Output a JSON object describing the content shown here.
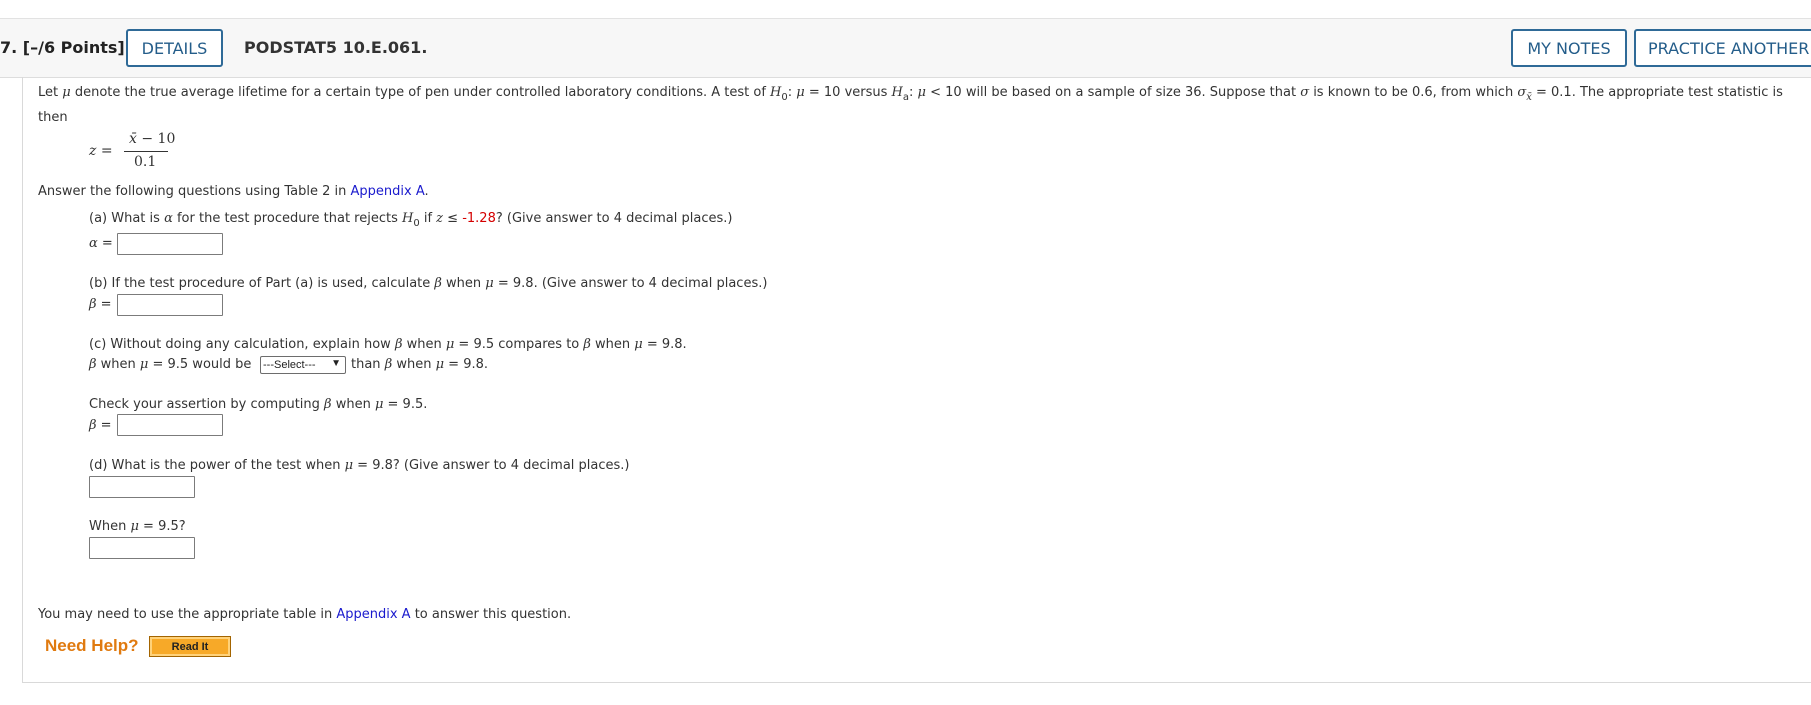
{
  "header": {
    "points": "7. [–/6 Points]",
    "details": "DETAILS",
    "code": "PODSTAT5 10.E.061.",
    "my_notes": "MY NOTES",
    "practice": "PRACTICE ANOTHER"
  },
  "problem": {
    "p1": "Let ",
    "mu": "μ",
    "p2": " denote the true average lifetime for a certain type of pen under controlled laboratory conditions. A test of ",
    "H": "H",
    "sub0": "0",
    "p3": ": ",
    "p4": " = 10 versus ",
    "suba": "a",
    "p5": ": ",
    "p6": " < 10 will be based on a sample of size 36. Suppose that ",
    "sigma": "σ",
    "p7": " is known to be 0.6, from which ",
    "subx": "x̄",
    "p8": " = 0.1. The appropriate test statistic is",
    "then": "then",
    "z": "z",
    "eq": " =",
    "numerator": "x̄ − 10",
    "denominator": "0.1"
  },
  "intro": {
    "text": "Answer the following questions using Table 2 in ",
    "link": "Appendix A",
    "period": "."
  },
  "part_a": {
    "t1": "(a) What is ",
    "alpha": "α",
    "t2": " for the test procedure that rejects ",
    "t3": " if ",
    "t4": " ≤ ",
    "value": "-1.28",
    "t5": "? (Give answer to 4 decimal places.)",
    "label_eq": " =",
    "answer": ""
  },
  "part_b": {
    "t1": "(b) If the test procedure of Part (a) is used, calculate ",
    "beta": "β",
    "t2": " when ",
    "t3": " = 9.8. (Give answer to 4 decimal places.)",
    "label_eq": " =",
    "answer": ""
  },
  "part_c": {
    "t1": "(c) Without doing any calculation, explain how ",
    "t2": " when ",
    "t3": " = 9.5 compares to ",
    "t4": " when ",
    "t5": " = 9.8.",
    "s1": " when ",
    "s2": " = 9.5 would be",
    "select_value": "---Select---",
    "s3": "than ",
    "s4": " when ",
    "s5": " = 9.8."
  },
  "check": {
    "t1": "Check your assertion by computing ",
    "t2": " when ",
    "t3": " = 9.5.",
    "label_eq": " =",
    "answer": ""
  },
  "part_d": {
    "t1": "(d) What is the power of the test when ",
    "t2": " = 9.8? (Give answer to 4 decimal places.)",
    "answer1": "",
    "when1": "When ",
    "when2": " = 9.5?",
    "answer2": ""
  },
  "footer": {
    "note1": "You may need to use the appropriate table in ",
    "link": "Appendix A",
    "note2": " to answer this question.",
    "need_help": "Need Help?",
    "read_it": "Read It"
  }
}
